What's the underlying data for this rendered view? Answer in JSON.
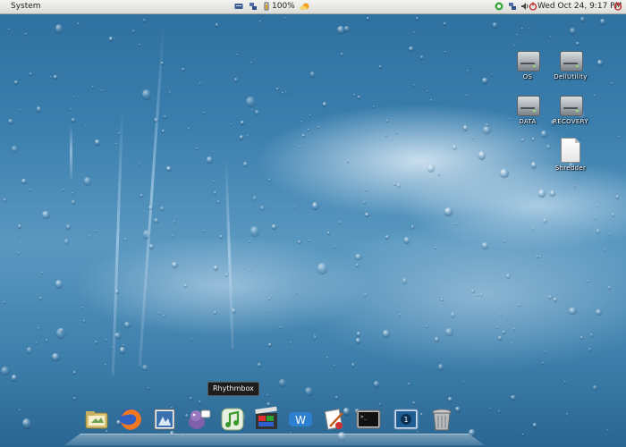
{
  "top_panel": {
    "menus": [
      "System"
    ],
    "battery_text": "100%",
    "clock": "Wed Oct 24,  9:17 PM"
  },
  "desktop_icons": [
    {
      "label": "OS",
      "icon": "hard-drive-icon"
    },
    {
      "label": "DellUtility",
      "icon": "hard-drive-icon"
    },
    {
      "label": "DATA",
      "icon": "hard-drive-icon"
    },
    {
      "label": "RECOVERY",
      "icon": "hard-drive-icon"
    },
    {
      "label": "Shredder",
      "icon": "document-icon"
    }
  ],
  "dock": {
    "tooltip": "Rhythmbox",
    "items": [
      "folder-icon",
      "firefox-icon",
      "photo-viewer-icon",
      "pidgin-icon",
      "rhythmbox-icon",
      "movie-player-icon",
      "writer-icon",
      "text-editor-icon",
      "terminal-icon",
      "workspace-switcher-icon",
      "trash-icon"
    ]
  },
  "colors": {
    "panel": "#e4e4e0",
    "sky": "#3b7fae"
  }
}
